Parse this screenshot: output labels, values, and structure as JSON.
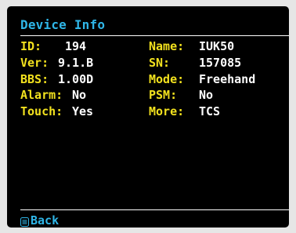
{
  "header": {
    "title": "Device Info"
  },
  "fields": [
    {
      "label": "ID:",
      "value": "194",
      "label2": "Name:",
      "value2": "IUK50"
    },
    {
      "label": "Ver:",
      "value": "9.1.B",
      "label2": "SN:",
      "value2": "157085"
    },
    {
      "label": "BBS:",
      "value": "1.00D",
      "label2": "Mode:",
      "value2": "Freehand"
    },
    {
      "label": "Alarm:",
      "value": "No",
      "label2": "PSM:",
      "value2": "No"
    },
    {
      "label": "Touch:",
      "value": "Yes",
      "label2": "More:",
      "value2": "TCS"
    }
  ],
  "footer": {
    "back_label": "Back",
    "icon": "menu-icon"
  },
  "colors": {
    "background": "#000000",
    "title": "#2fb6e8",
    "label": "#f2e11e",
    "value": "#ffffff"
  }
}
